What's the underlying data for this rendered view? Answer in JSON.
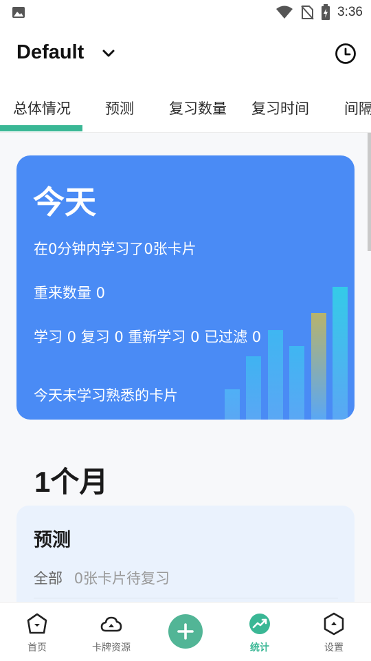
{
  "status_bar": {
    "time": "3:36",
    "icons": [
      "image-notification-icon",
      "wifi-icon",
      "no-sim-icon",
      "battery-charging-icon"
    ]
  },
  "header": {
    "deck_name": "Default",
    "icons": [
      "chevron-down-icon",
      "history-clock-icon"
    ]
  },
  "tabs": [
    {
      "label": "总体情况",
      "active": true
    },
    {
      "label": "预测",
      "active": false
    },
    {
      "label": "复习数量",
      "active": false
    },
    {
      "label": "复习时间",
      "active": false
    },
    {
      "label": "间隔",
      "active": false
    }
  ],
  "today": {
    "title": "今天",
    "studied_line": "在0分钟内学习了0张卡片",
    "again_line": "重来数量 0",
    "breakdown_line": "学习 0 复习 0 重新学习 0 已过滤 0",
    "mature_line": "今天未学习熟悉的卡片"
  },
  "month": {
    "title": "1个月"
  },
  "forecast": {
    "title": "预测",
    "row_label": "全部",
    "row_value": "0张卡片待复习"
  },
  "bottom_nav": [
    {
      "label": "首页",
      "icon": "home-icon",
      "active": false
    },
    {
      "label": "卡牌资源",
      "icon": "cloud-icon",
      "active": false
    },
    {
      "label": "",
      "icon": "add-icon",
      "active": false
    },
    {
      "label": "统计",
      "icon": "stats-icon",
      "active": true
    },
    {
      "label": "设置",
      "icon": "settings-icon",
      "active": false
    }
  ],
  "colors": {
    "accent": "#3ab795",
    "today_card": "#4a8bf5",
    "forecast_card": "#eaf2fd",
    "fab": "#52b596"
  }
}
